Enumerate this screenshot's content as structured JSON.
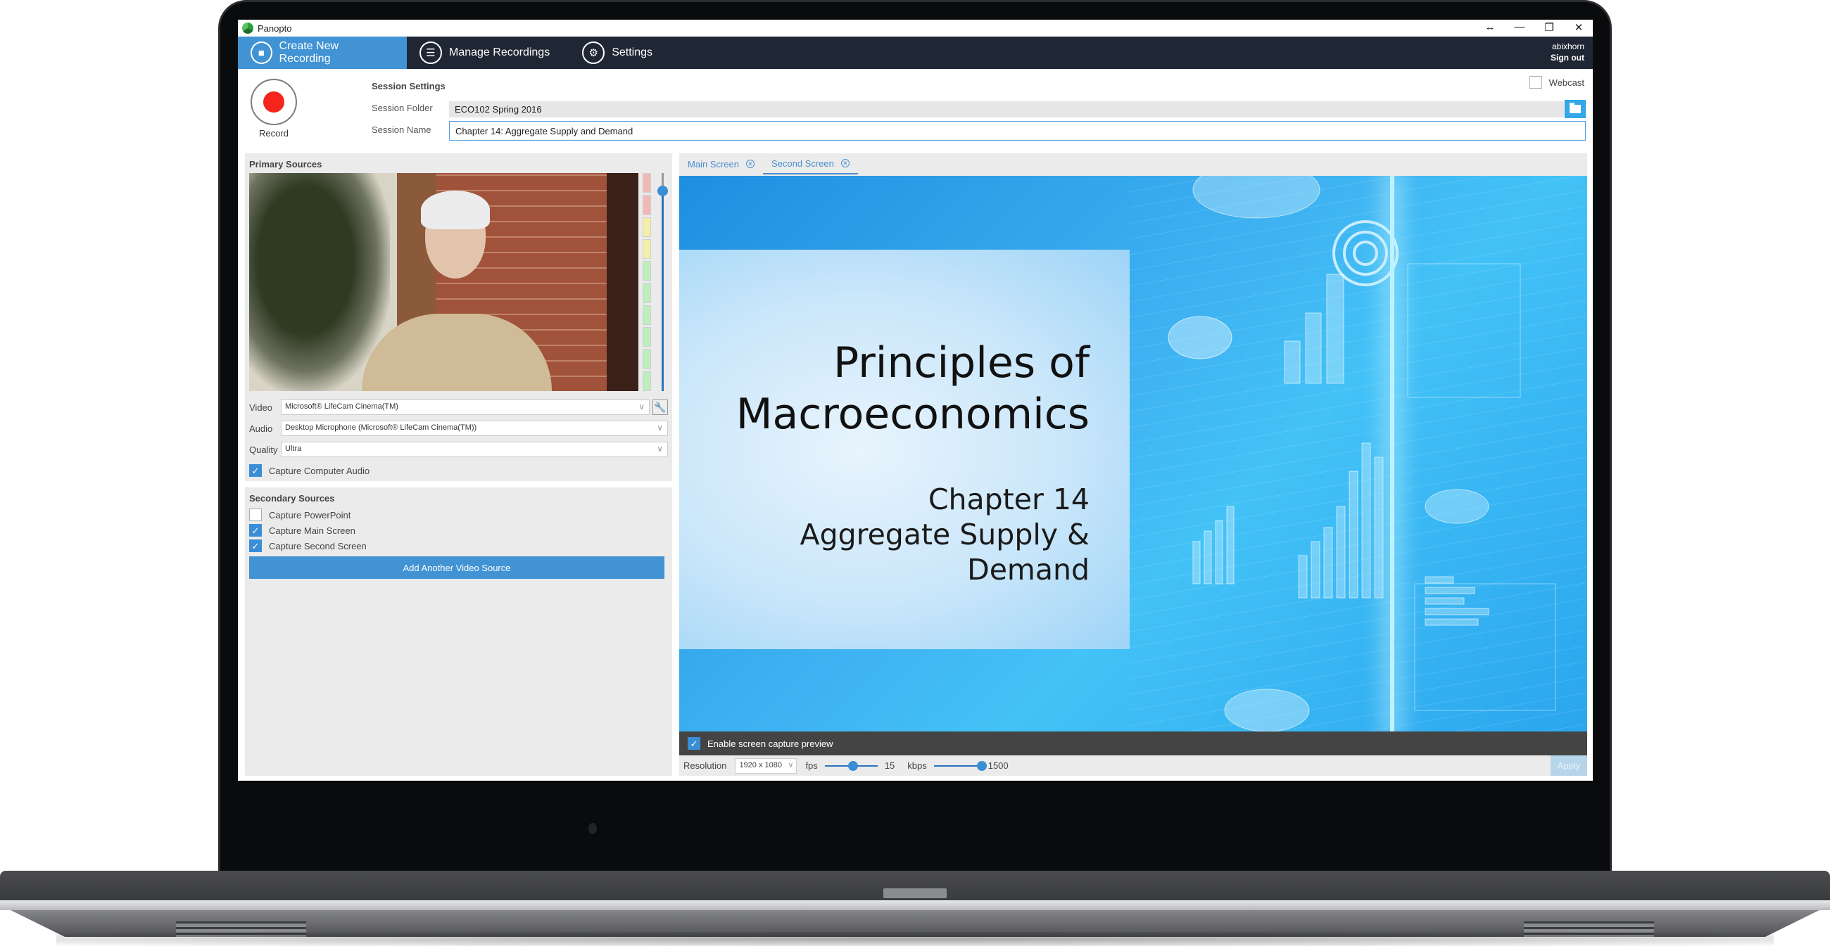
{
  "window": {
    "title": "Panopto",
    "controls": [
      "resize-arrows-icon",
      "minimize-icon",
      "restore-icon",
      "close-icon"
    ]
  },
  "nav": {
    "items": [
      {
        "label": "Create New Recording",
        "icon": "video-camera-icon",
        "active": true
      },
      {
        "label": "Manage Recordings",
        "icon": "list-icon",
        "active": false
      },
      {
        "label": "Settings",
        "icon": "gear-icon",
        "active": false
      }
    ],
    "user": "abixhorn",
    "sign_out": "Sign out"
  },
  "record": {
    "label": "Record",
    "color": "#f5251b"
  },
  "session": {
    "title": "Session Settings",
    "folder_label": "Session Folder",
    "folder_value": "ECO102 Spring 2016",
    "name_label": "Session Name",
    "name_value": "Chapter 14: Aggregate Supply and Demand",
    "webcast_label": "Webcast",
    "webcast_checked": false
  },
  "primary_sources": {
    "title": "Primary Sources",
    "audio_level_segments": [
      "red",
      "red",
      "yellow",
      "yellow",
      "green",
      "green",
      "green",
      "green",
      "green",
      "green"
    ],
    "volume": 0.92,
    "video_label": "Video",
    "video_value": "Microsoft® LifeCam Cinema(TM)",
    "audio_label": "Audio",
    "audio_value": "Desktop Microphone (Microsoft® LifeCam Cinema(TM))",
    "quality_label": "Quality",
    "quality_value": "Ultra",
    "capture_computer_audio": "Capture Computer Audio",
    "capture_computer_audio_checked": true
  },
  "secondary_sources": {
    "title": "Secondary Sources",
    "items": [
      {
        "label": "Capture PowerPoint",
        "checked": false
      },
      {
        "label": "Capture Main Screen",
        "checked": true
      },
      {
        "label": "Capture Second Screen",
        "checked": true
      }
    ],
    "add_button": "Add Another Video Source"
  },
  "preview": {
    "tabs": [
      {
        "label": "Main Screen",
        "active": false
      },
      {
        "label": "Second Screen",
        "active": true
      }
    ],
    "slide": {
      "title_line1": "Principles of",
      "title_line2": "Macroeconomics",
      "sub_line1": "Chapter 14",
      "sub_line2": "Aggregate Supply & Demand"
    },
    "enable_preview_label": "Enable screen capture preview",
    "enable_preview_checked": true,
    "resolution_label": "Resolution",
    "resolution_value": "1920 x 1080",
    "fps_label": "fps",
    "fps_value": "15",
    "fps_fraction": 0.55,
    "kbps_label": "kbps",
    "kbps_value": "1500",
    "kbps_fraction": 1.0,
    "apply_label": "Apply"
  },
  "colors": {
    "accent": "#4193d3",
    "nav_bg": "#1f2734",
    "meter_red": "#f2b8b8",
    "meter_yellow": "#f3efa8",
    "meter_green": "#bfeebd"
  }
}
